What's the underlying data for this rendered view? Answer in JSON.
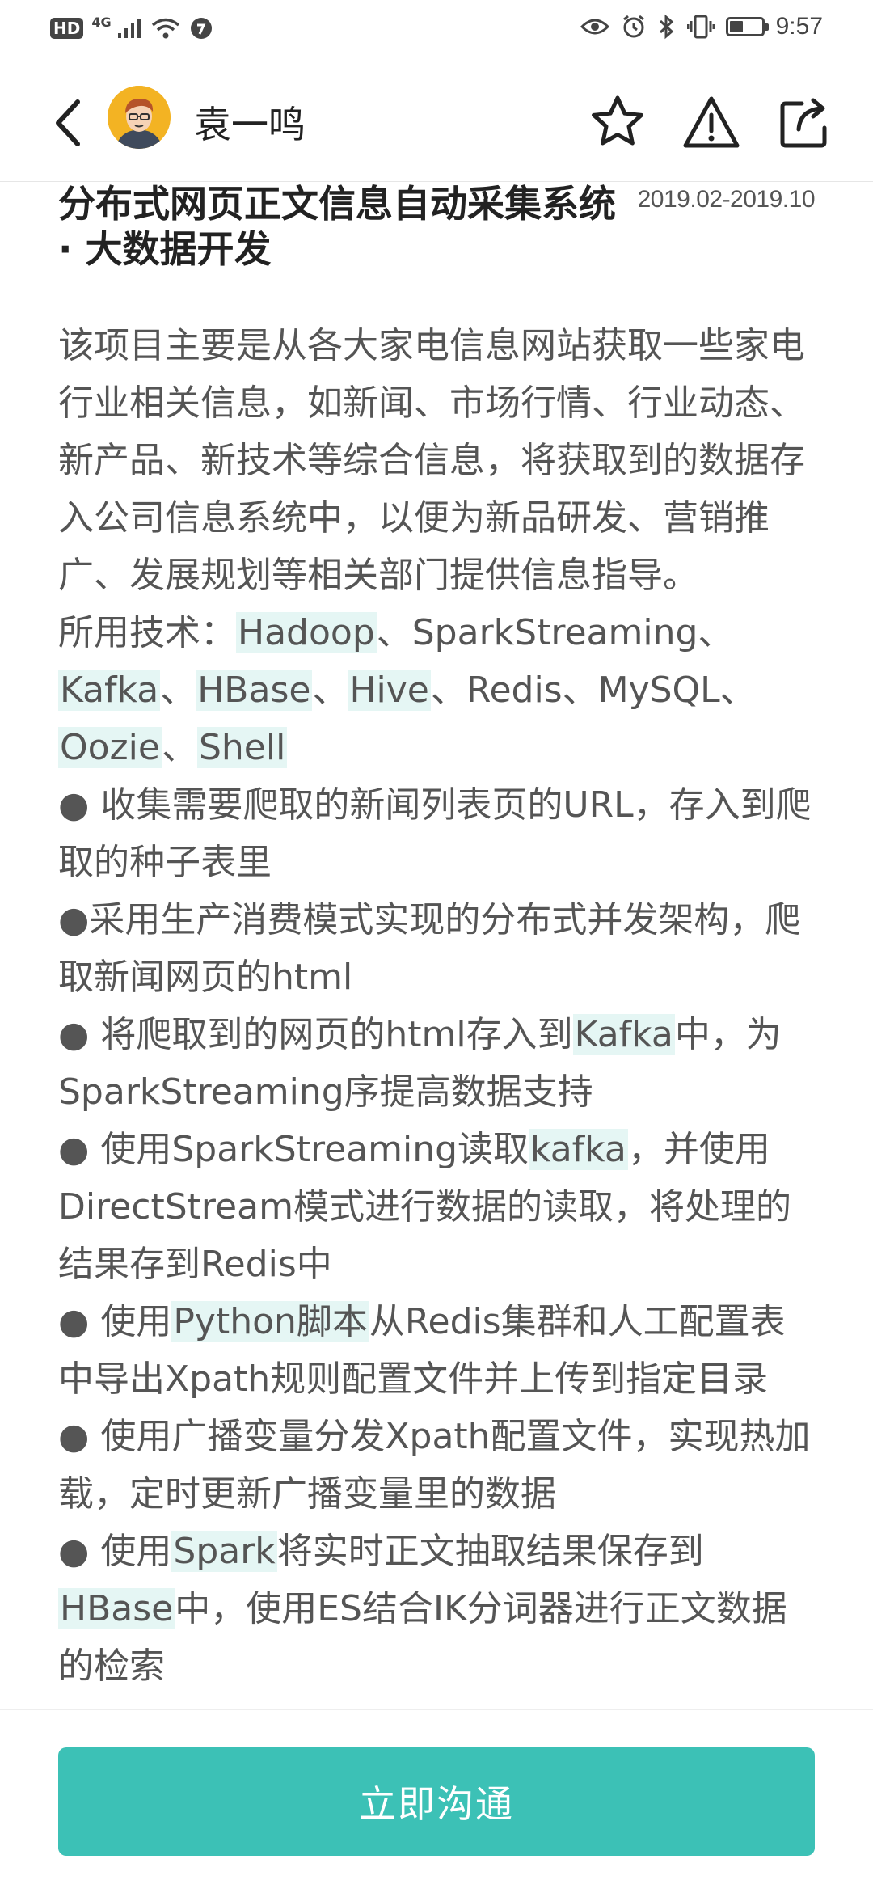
{
  "status_bar": {
    "hd": "HD",
    "network": "4G",
    "time": "9:57",
    "battery_level": 0.4
  },
  "header": {
    "name": "袁一鸣",
    "icons": [
      "back-chevron-icon",
      "avatar",
      "star-icon",
      "warning-icon",
      "share-icon"
    ]
  },
  "project": {
    "title": "分布式网页正文信息自动采集系统 · 大数据开发",
    "period": "2019.02-2019.10",
    "intro": "该项目主要是从各大家电信息网站获取一些家电行业相关信息，如新闻、市场行情、行业动态、 新产品、新技术等综合信息，将获取到的数据存入公司信息系统中，以便为新品研发、营销推广、发展规划等相关部门提供信息指导。",
    "tech_prefix": "所用技术：",
    "tech": [
      "Hadoop",
      "SparkStreaming",
      "Kafka",
      "HBase",
      "Hive",
      "Redis",
      "MySQL",
      "Oozie",
      "Shell"
    ],
    "tech_highlight": [
      "Hadoop",
      "Kafka",
      "HBase",
      "Hive",
      "Oozie",
      "Shell"
    ],
    "bullets": [
      [
        {
          "t": "● 收集需要爬取的新闻列表页的URL，存入到爬取的种子表里"
        }
      ],
      [
        {
          "t": "●采用生产消费模式实现的分布式并发架构，爬取新闻网页的html"
        }
      ],
      [
        {
          "t": "● 将爬取到的网页的html存入到"
        },
        {
          "t": "Kafka",
          "hl": true
        },
        {
          "t": "中，为SparkStreaming序提高数据支持"
        }
      ],
      [
        {
          "t": "● 使用SparkStreaming读取"
        },
        {
          "t": "kafka",
          "hl": true
        },
        {
          "t": "，并使用DirectStream模式进行数据的读取，将处理的结果存到Redis中"
        }
      ],
      [
        {
          "t": "● 使用"
        },
        {
          "t": "Python脚本",
          "hl": true
        },
        {
          "t": "从Redis集群和人工配置表中导出Xpath规则配置文件并上传到指定目录"
        }
      ],
      [
        {
          "t": "● 使用广播变量分发Xpath配置文件，实现热加载，定时更新广播变量里的数据"
        }
      ],
      [
        {
          "t": "● 使用"
        },
        {
          "t": "Spark",
          "hl": true
        },
        {
          "t": "将实时正文抽取结果保存到"
        },
        {
          "t": "HBase",
          "hl": true
        },
        {
          "t": "中，使用ES结合IK分词器进行正文数据的检索"
        }
      ]
    ]
  },
  "actions": {
    "contact_label": "立即沟通"
  },
  "colors": {
    "accent": "#3cc1b6",
    "highlight": "#e5f6f4",
    "avatar_bg": "#f3b323"
  }
}
